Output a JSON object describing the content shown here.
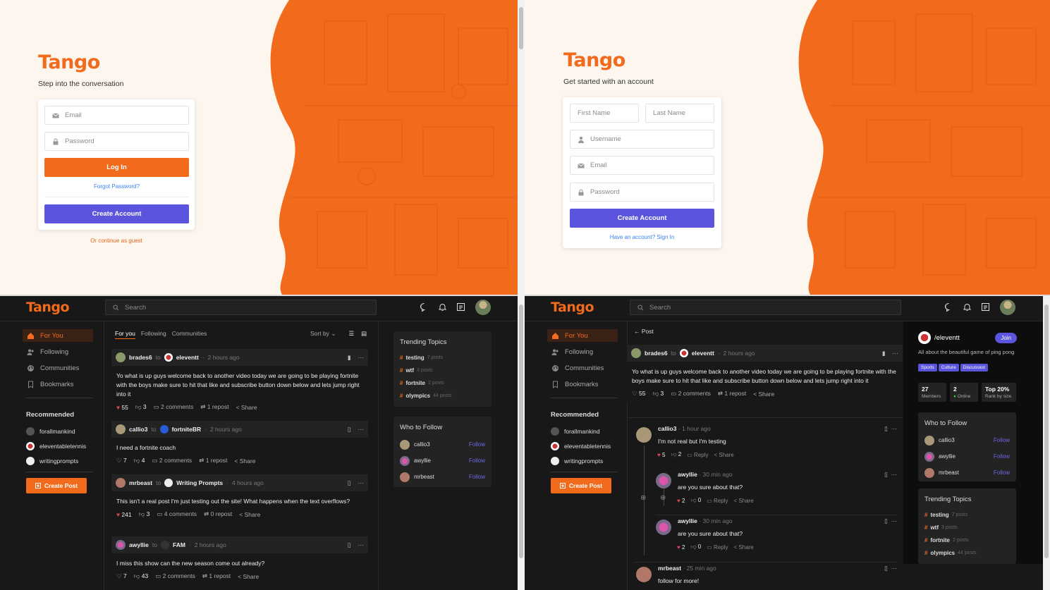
{
  "brand": {
    "name": "Tango",
    "orange": "#f26a1b",
    "purple": "#5a55dc"
  },
  "login": {
    "tagline": "Step into the conversation",
    "email_placeholder": "Email",
    "password_placeholder": "Password",
    "login_label": "Log In",
    "forgot_label": "Forgot Password?",
    "create_label": "Create Account",
    "guest_label": "Or continue as guest"
  },
  "signup": {
    "tagline": "Get started with an account",
    "first_placeholder": "First Name",
    "last_placeholder": "Last Name",
    "username_placeholder": "Username",
    "email_placeholder": "Email",
    "password_placeholder": "Password",
    "create_label": "Create Account",
    "signin_label": "Have an account? Sign In"
  },
  "app": {
    "search_placeholder": "Search",
    "nav": [
      {
        "label": "For You",
        "icon": "home-icon"
      },
      {
        "label": "Following",
        "icon": "users-icon"
      },
      {
        "label": "Communities",
        "icon": "globe-icon"
      },
      {
        "label": "Bookmarks",
        "icon": "bookmark-icon"
      }
    ],
    "recommended_title": "Recommended",
    "communities": [
      "forallmankind",
      "eleventabletennis",
      "writingprompts"
    ],
    "create_post": "Create Post",
    "feed_tabs": [
      "For you",
      "Following",
      "Communities"
    ],
    "sort_label": "Sort by",
    "posts": [
      {
        "user": "brades6",
        "to": "to",
        "community": "eleventt",
        "time": "2 hours ago",
        "text": "Yo what is up guys welcome back to another video today we are going to be playing fortnite with the boys make sure to hit that like and subscribe button down below and lets jump right into it",
        "likes": "55",
        "dislikes": "3",
        "comments": "2 comments",
        "reposts": "1 repost",
        "share": "Share"
      },
      {
        "user": "callio3",
        "to": "to",
        "community": "fortniteBR",
        "time": "2 hours ago",
        "text": "I need a fortnite coach",
        "likes": "7",
        "dislikes": "4",
        "comments": "2 comments",
        "reposts": "1 repost",
        "share": "Share"
      },
      {
        "user": "mrbeast",
        "to": "to",
        "community": "Writing Prompts",
        "time": "4 hours ago",
        "text": "This isn't a real post I'm just testing out the site! What happens when the text overflows?",
        "likes": "241",
        "dislikes": "3",
        "comments": "4 comments",
        "reposts": "0 repost",
        "share": "Share"
      },
      {
        "user": "awyllie",
        "to": "to",
        "community": "FAM",
        "time": "2 hours ago",
        "text": "I miss this show can the new season come out already?",
        "likes": "7",
        "dislikes": "43",
        "comments": "2 comments",
        "reposts": "1 repost",
        "share": "Share"
      }
    ],
    "trending_title": "Trending Topics",
    "trending": [
      {
        "tag": "testing",
        "count": "7 posts"
      },
      {
        "tag": "wtf",
        "count": "3 posts"
      },
      {
        "tag": "fortnite",
        "count": "2 posts"
      },
      {
        "tag": "olympics",
        "count": "44 posts"
      }
    ],
    "follow_title": "Who to Follow",
    "follow": [
      {
        "name": "callio3",
        "action": "Follow"
      },
      {
        "name": "awyllie",
        "action": "Follow"
      },
      {
        "name": "mrbeast",
        "action": "Follow"
      }
    ]
  },
  "detail": {
    "back_label": "Post",
    "comments": [
      {
        "user": "callio3",
        "time": "1 hour ago",
        "text": "I'm not real but I'm testing",
        "likes": "5",
        "dislikes": "2",
        "reply": "Reply",
        "share": "Share"
      },
      {
        "user": "awyllie",
        "time": "30 min ago",
        "text": "are you sure about that?",
        "likes": "2",
        "dislikes": "0",
        "reply": "Reply",
        "share": "Share"
      },
      {
        "user": "awyllie",
        "time": "30 min ago",
        "text": "are you sure about that?",
        "likes": "2",
        "dislikes": "0",
        "reply": "Reply",
        "share": "Share"
      },
      {
        "user": "mrbeast",
        "time": "25 min ago",
        "text": "follow for more!"
      }
    ],
    "community": {
      "name": "/eleventt",
      "join": "Join",
      "description": "All about the beautiful game of ping pong",
      "tags": [
        "Sports",
        "Culture",
        "Discussion"
      ],
      "members": "27",
      "members_label": "Members",
      "online": "2",
      "online_label": "Online",
      "rank": "Top 20%",
      "rank_label": "Rank by size"
    }
  }
}
